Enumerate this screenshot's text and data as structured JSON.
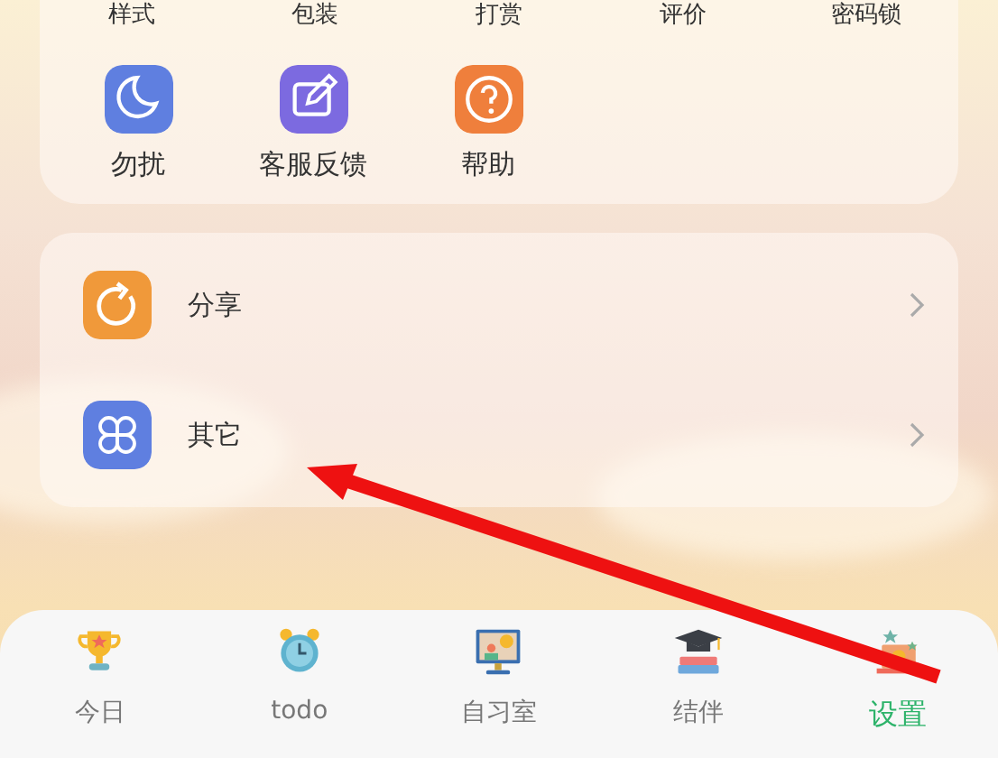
{
  "feature_grid": {
    "cut_row": [
      "样式",
      "包装",
      "打赏",
      "评价",
      "密码锁"
    ],
    "items": [
      {
        "label": "勿扰",
        "kind": "moon",
        "color": "#5f7fe0"
      },
      {
        "label": "客服反馈",
        "kind": "edit",
        "color": "#7c6ae0"
      },
      {
        "label": "帮助",
        "kind": "help",
        "color": "#ef7f3c"
      }
    ]
  },
  "list": [
    {
      "label": "分享",
      "kind": "share",
      "color": "#f0993a"
    },
    {
      "label": "其它",
      "kind": "other",
      "color": "#5f7fe0"
    }
  ],
  "tabs": [
    {
      "label": "今日",
      "kind": "trophy",
      "selected": false
    },
    {
      "label": "todo",
      "kind": "clock",
      "selected": false
    },
    {
      "label": "自习室",
      "kind": "monitor",
      "selected": false
    },
    {
      "label": "结伴",
      "kind": "books",
      "selected": false
    },
    {
      "label": "设置",
      "kind": "desk",
      "selected": true
    }
  ]
}
